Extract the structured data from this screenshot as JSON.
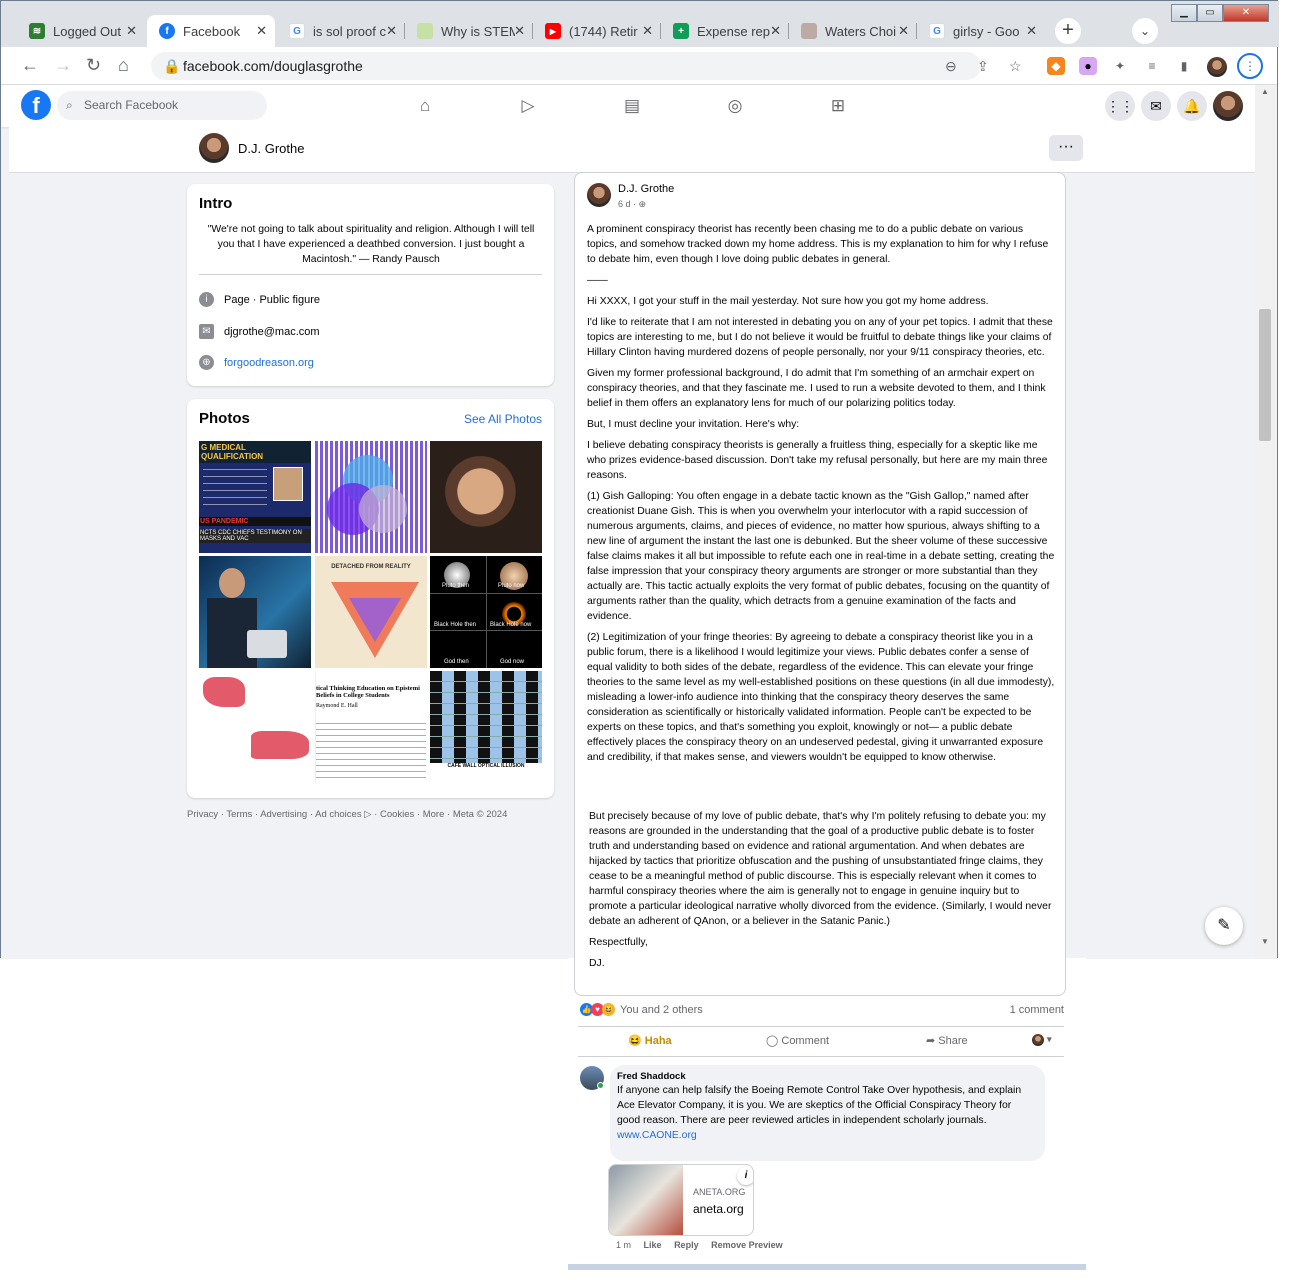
{
  "browser": {
    "tabs": [
      {
        "title": "Logged Out",
        "icon": "green-leaf-icon",
        "color": "#2e7d32"
      },
      {
        "title": "Facebook",
        "icon": "facebook-icon",
        "color": "#1877f2"
      },
      {
        "title": "is sol proof c",
        "icon": "google-icon",
        "color": "#4285f4"
      },
      {
        "title": "Why is STEM",
        "icon": "page-icon",
        "color": "#7cb342"
      },
      {
        "title": "(1744) Retir",
        "icon": "youtube-icon",
        "color": "#ff0000"
      },
      {
        "title": "Expense rep",
        "icon": "sheets-icon",
        "color": "#0f9d58"
      },
      {
        "title": "Waters Choi",
        "icon": "waters-icon",
        "color": "#8d6e63"
      },
      {
        "title": "girlsy - Goo",
        "icon": "google-icon",
        "color": "#4285f4"
      }
    ],
    "url": "facebook.com/douglasgrothe"
  },
  "fb": {
    "search_placeholder": "Search Facebook",
    "profile_name": "D.J. Grothe",
    "intro": {
      "title": "Intro",
      "quote": "\"We're not going to talk about spirituality and religion. Although I will tell you that I have experienced a deathbed conversion. I just bought a Macintosh.\" — Randy Pausch",
      "page_type": "Page · Public figure",
      "email": "djgrothe@mac.com",
      "website": "forgoodreason.org"
    },
    "photos": {
      "title": "Photos",
      "see_all": "See All Photos",
      "p1_title": "G MEDICAL QUALIFICATION",
      "p1_caption": "US PANDEMIC",
      "p1_sub": "NCTS CDC CHIEFS TESTIMONY ON MASKS AND VAC",
      "p5_title": "DETACHED FROM REALITY",
      "p6_labels": [
        "Pluto then",
        "Pluto now",
        "Black Hole then",
        "Black Hole now",
        "God then",
        "God now"
      ],
      "p8_title": "tical Thinking Education on Epistemi Beliefs in College Students",
      "p8_author": "Raymond E. Hall",
      "p9_caption": "CAFE WALL OPTICAL ILLUSION"
    },
    "footer": "Privacy · Terms · Advertising · Ad choices ▷ · Cookies · More · Meta © 2024",
    "post": {
      "author": "D.J. Grothe",
      "time": "6 d ·",
      "paragraphs": [
        "A prominent conspiracy theorist has recently been chasing me to do a public debate on various topics, and somehow tracked down my home address. This is my explanation to him for why I refuse to debate him, even though I love doing public debates in general.",
        "——",
        "Hi XXXX, I got your stuff in the mail yesterday. Not sure how you got my home address.",
        "I'd like to reiterate that I am not interested in debating you on any of your pet topics. I admit that these topics are interesting to me, but I do not believe it would be fruitful to debate things like your claims of Hillary Clinton having murdered dozens of people personally, nor your 9/11 conspiracy theories, etc.",
        "Given my former professional background, I do admit that I'm something of an armchair expert on conspiracy theories, and that they fascinate me. I used to run a website devoted to them, and I think belief in them offers an explanatory lens for much of our polarizing politics today.",
        "But, I must decline your invitation. Here's why:",
        "I believe debating conspiracy theorists is generally a fruitless thing, especially for a skeptic like me who prizes evidence-based discussion. Don't take my refusal personally, but here are my main three reasons.",
        "(1) Gish Galloping: You often engage in a debate tactic known as the \"Gish Gallop,\" named after creationist Duane Gish. This is when you overwhelm your interlocutor with a rapid succession of numerous arguments, claims, and pieces of evidence, no matter how spurious, always shifting to a new line of argument the instant the last one is debunked. But the sheer volume of these successive false claims makes it all but impossible to refute each one in real-time in a debate setting, creating the false impression that your conspiracy theory arguments are stronger or more substantial than they actually are. This tactic actually exploits the very format of public debates, focusing on the quantity of arguments rather than the quality, which detracts from a genuine examination of the facts and evidence.",
        "(2) Legitimization of your fringe theories: By agreeing to debate a conspiracy theorist like you in a public forum, there is a likelihood I would legitimize your views. Public debates confer a sense of equal validity to both sides of the debate, regardless of the evidence. This can elevate your fringe theories to the same level as my well-established positions on these questions (in all due immodesty), misleading a lower-info audience into thinking that the conspiracy theory deserves the same consideration as scientifically or historically validated information. People can't be expected to be experts on these topics, and that's something you exploit, knowingly or not— a public debate effectively places the conspiracy theory on an undeserved pedestal, giving it unwarranted exposure and credibility, if that makes sense, and viewers wouldn't be equipped to know otherwise."
      ],
      "paragraphs2": [
        "But precisely because of my love of public debate, that's why I'm politely refusing to debate you: my reasons are grounded in the understanding that the goal of a productive public debate is to foster truth and understanding based on evidence and rational argumentation. And when debates are hijacked by tactics that prioritize obfuscation and the pushing of unsubstantiated fringe claims, they cease to be a meaningful method of public discourse. This is especially relevant when it comes to harmful conspiracy theories where the aim is generally not to engage in genuine inquiry but to promote a particular ideological narrative wholly divorced from the evidence. (Similarly, I would never debate an adherent of QAnon, or a believer in the Satanic Panic.)",
        "Respectfully,",
        "DJ."
      ],
      "reactions_text": "You and 2 others",
      "comment_count": "1 comment",
      "actions": {
        "haha": "Haha",
        "comment": "Comment",
        "share": "Share"
      },
      "comment": {
        "author": "Fred Shaddock",
        "text": "If anyone can help falsify the Boeing Remote Control Take Over hypothesis, and explain Ace Elevator Company, it is you. We are skeptics of the Official Conspiracy Theory for good reason. There are peer reviewed articles in independent scholarly journals.",
        "link": "www.CAONE.org",
        "preview_domain": "ANETA.ORG",
        "preview_title": "aneta.org",
        "time": "1 m",
        "like": "Like",
        "reply": "Reply",
        "remove": "Remove Preview"
      }
    }
  }
}
